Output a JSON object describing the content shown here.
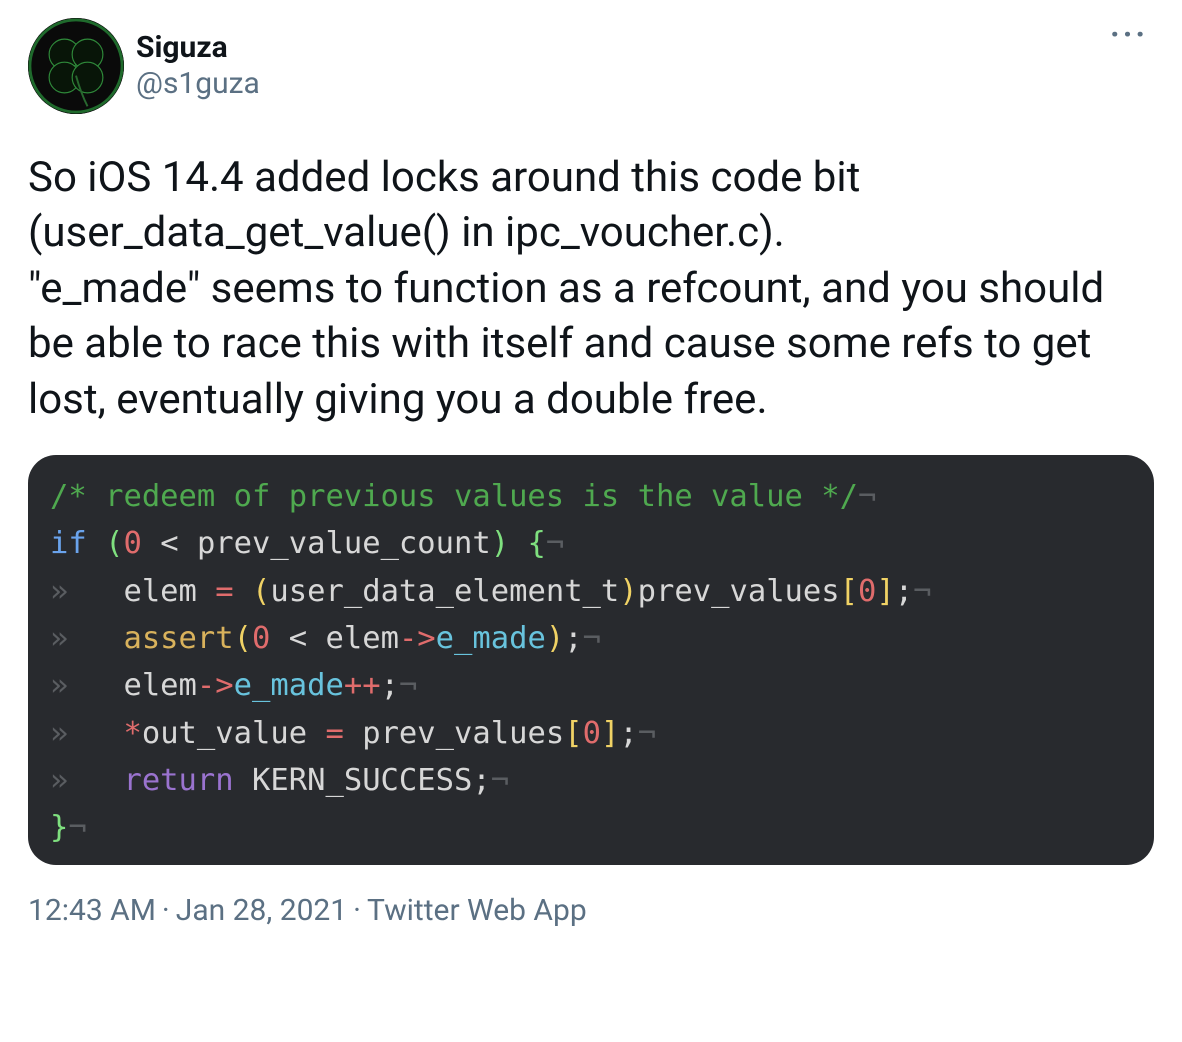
{
  "user": {
    "display_name": "Siguza",
    "handle": "@s1guza"
  },
  "more_label": "···",
  "tweet_text": "So iOS 14.4 added locks around this code bit (user_data_get_value() in ipc_voucher.c).\n\"e_made\" seems to function as a refcount, and you should be able to race this with itself and cause some refs to get lost, eventually giving you a double free.",
  "code": {
    "comment": "/* redeem of previous values is the value */",
    "line2": {
      "if": "if",
      "open": " (",
      "zero": "0",
      "lt": " < ",
      "ident": "prev_value_count",
      "close": ") {"
    },
    "line3": {
      "indent": "»   ",
      "elem": "elem ",
      "eq": "= ",
      "popen": "(",
      "cast": "user_data_element_t",
      "pclose": ")",
      "ident": "prev_values",
      "bopen": "[",
      "zero": "0",
      "bclose": "]",
      "semi": ";"
    },
    "line4": {
      "indent": "»   ",
      "func": "assert",
      "popen": "(",
      "zero": "0",
      "lt": " < ",
      "elem": "elem",
      "arrow": "->",
      "member": "e_made",
      "pclose": ")",
      "semi": ";"
    },
    "line5": {
      "indent": "»   ",
      "elem": "elem",
      "arrow": "->",
      "member": "e_made",
      "incr": "++",
      "semi": ";"
    },
    "line6": {
      "indent": "»   ",
      "star": "*",
      "out": "out_value ",
      "eq": "= ",
      "ident": "prev_values",
      "bopen": "[",
      "zero": "0",
      "bclose": "]",
      "semi": ";"
    },
    "line7": {
      "indent": "»   ",
      "ret": "return",
      "sp": " ",
      "val": "KERN_SUCCESS",
      "semi": ";"
    },
    "line8": {
      "brace": "}"
    },
    "eol": "¬"
  },
  "meta": {
    "time": "12:43 AM",
    "date": "Jan 28, 2021",
    "source": "Twitter Web App",
    "sep": "·"
  }
}
